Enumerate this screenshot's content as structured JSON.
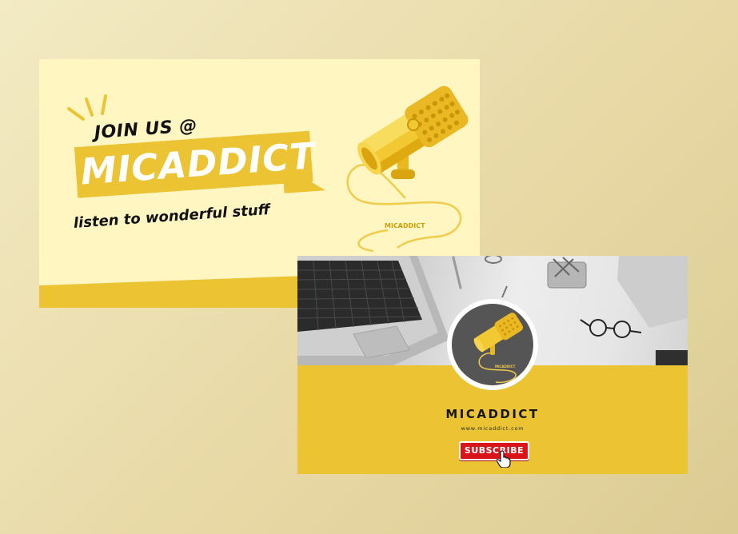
{
  "card1": {
    "heading": "JOIN US @",
    "brand": "MICADDICT",
    "tagline": "listen to wonderful stuff",
    "mic_label": "MICADDICT"
  },
  "card2": {
    "channel_name": "MICADDICT",
    "url": "www.micaddict.com",
    "avatar_label": "MICADDICT",
    "subscribe_label": "SUBSCRIBE"
  },
  "colors": {
    "accent_yellow": "#ecc433",
    "card_cream": "#fff6c2",
    "subscribe_red": "#d9141b",
    "background": "#e8d9a6"
  },
  "icons": [
    "microphone-icon",
    "sparkle-lines-icon",
    "hand-cursor-icon"
  ]
}
